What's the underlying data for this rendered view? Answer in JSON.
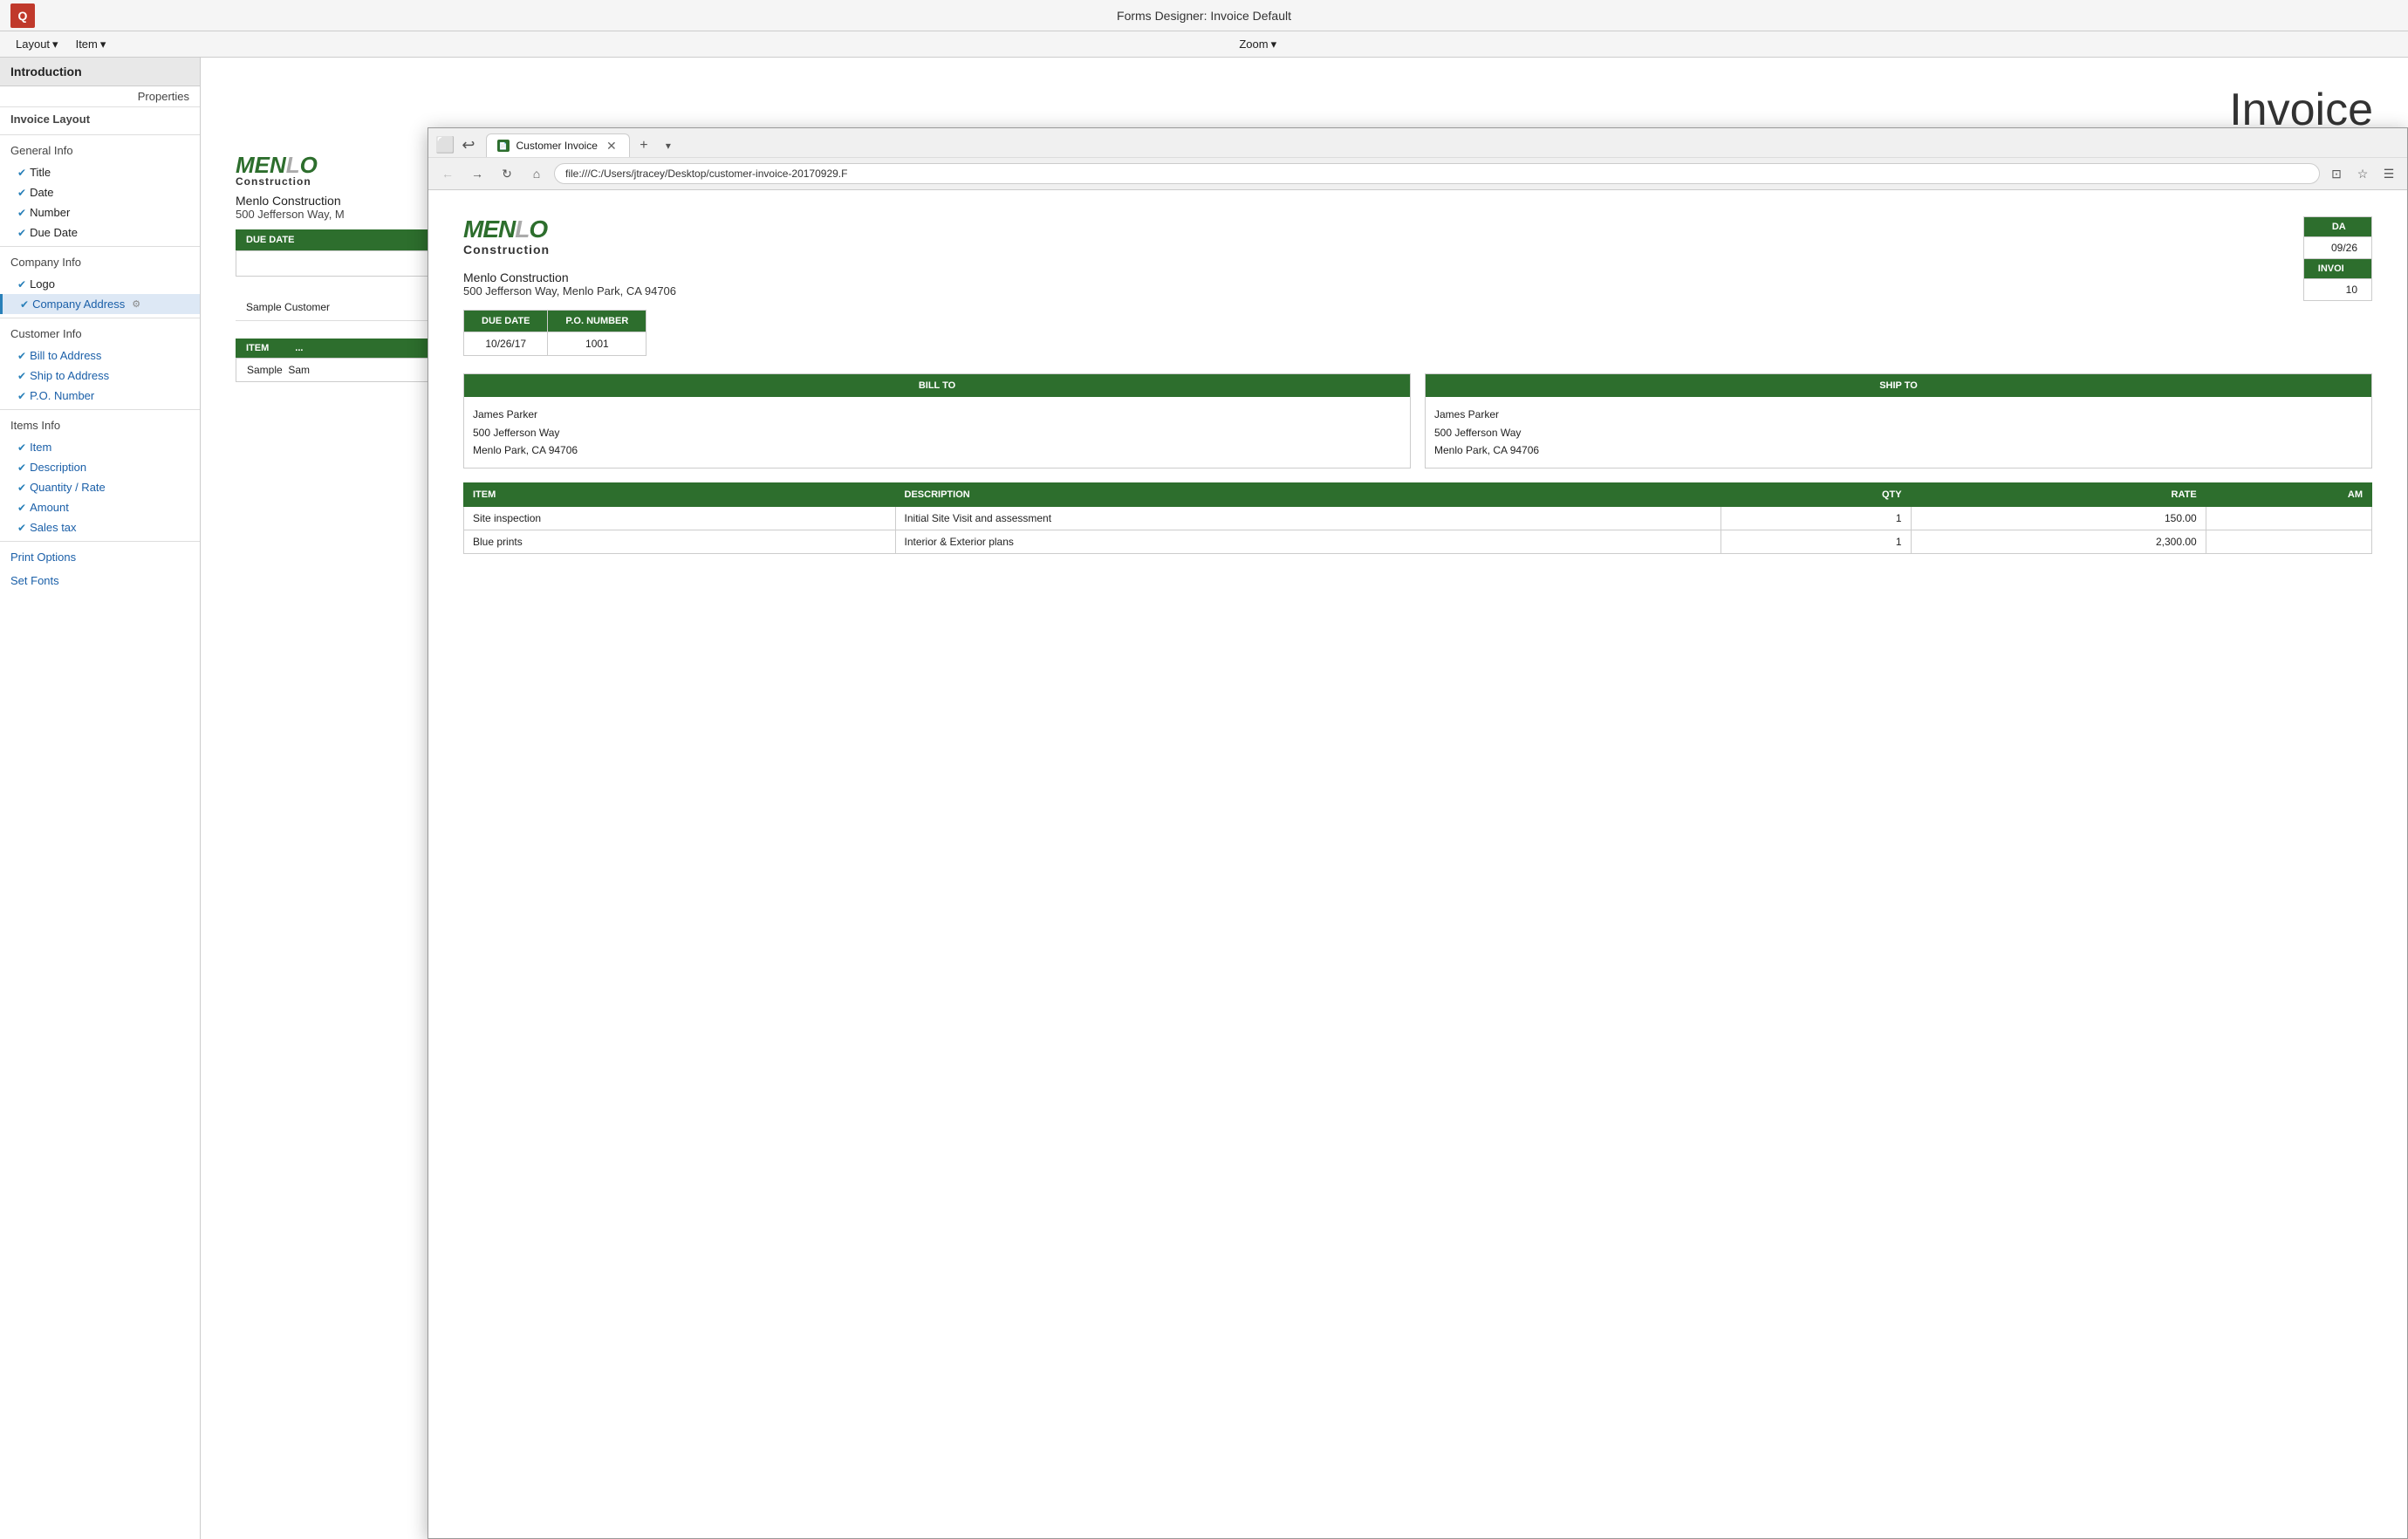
{
  "titleBar": {
    "logo": "Q",
    "title": "Forms Designer:  Invoice Default"
  },
  "menuBar": {
    "items": [
      {
        "label": "Layout",
        "hasArrow": true
      },
      {
        "label": "Item",
        "hasArrow": true
      },
      {
        "label": "Zoom",
        "hasArrow": true
      }
    ]
  },
  "leftPanel": {
    "header": "Introduction",
    "propertiesLabel": "Properties",
    "sections": [
      {
        "title": "Invoice Layout",
        "items": []
      },
      {
        "title": "General Info",
        "items": [
          {
            "label": "Title",
            "checked": true,
            "hasGear": false
          },
          {
            "label": "Date",
            "checked": true,
            "hasGear": false
          },
          {
            "label": "Number",
            "checked": true,
            "hasGear": false
          },
          {
            "label": "Due Date",
            "checked": true,
            "hasGear": false
          }
        ]
      },
      {
        "title": "Company Info",
        "items": [
          {
            "label": "Logo",
            "checked": true,
            "hasGear": false
          },
          {
            "label": "Company Address",
            "checked": true,
            "hasGear": true,
            "highlighted": true
          }
        ]
      },
      {
        "title": "Customer Info",
        "items": [
          {
            "label": "Bill to Address",
            "checked": true,
            "hasGear": false
          },
          {
            "label": "Ship to Address",
            "checked": true,
            "hasGear": false
          },
          {
            "label": "P.O. Number",
            "checked": true,
            "hasGear": false
          }
        ]
      },
      {
        "title": "Items Info",
        "items": [
          {
            "label": "Item",
            "checked": true,
            "hasGear": false
          },
          {
            "label": "Description",
            "checked": true,
            "hasGear": false
          },
          {
            "label": "Quantity / Rate",
            "checked": true,
            "hasGear": false
          },
          {
            "label": "Amount",
            "checked": true,
            "hasGear": false
          },
          {
            "label": "Sales tax",
            "checked": true,
            "hasGear": false
          }
        ]
      },
      {
        "title": "Print Options",
        "items": []
      },
      {
        "title": "Set Fonts",
        "items": []
      }
    ]
  },
  "invoicePreview": {
    "title": "Invoice",
    "logo": {
      "menlo": "MENLO",
      "construction": "Construction"
    },
    "company": {
      "name": "Menlo Construction",
      "address": "500 Jefferson Way, M"
    },
    "dueDate": {
      "header": "DUE DATE",
      "value": ""
    },
    "sampleCustomer": "Sample Customer",
    "itemBar": {
      "item": "ITEM",
      "sample": "Sam"
    }
  },
  "browser": {
    "tab": {
      "label": "Customer Invoice",
      "favicon": "📄"
    },
    "addressBar": "file:///C:/Users/jtracey/Desktop/customer-invoice-20170929.F",
    "invoice": {
      "logo": {
        "menlo": "MENLO",
        "construction": "Construction"
      },
      "company": {
        "name": "Menlo Construction",
        "address": "500 Jefferson Way, Menlo Park, CA 94706"
      },
      "dueDateTable": {
        "headers": [
          "DUE DATE",
          "P.O. NUMBER"
        ],
        "values": [
          "10/26/17",
          "1001"
        ]
      },
      "rightInfo": {
        "dateLabel": "DA",
        "dateValue": "09/26",
        "invoiceLabel": "INVOI",
        "invoiceValue": "10"
      },
      "billTo": {
        "header": "BILL TO",
        "name": "James Parker",
        "address1": "500 Jefferson Way",
        "address2": "Menlo Park, CA 94706"
      },
      "shipTo": {
        "header": "SHIP TO",
        "name": "James Parker",
        "address1": "500 Jefferson Way",
        "address2": "Menlo Park, CA 94706"
      },
      "itemsTable": {
        "headers": [
          "ITEM",
          "DESCRIPTION",
          "QTY",
          "RATE",
          "AM"
        ],
        "rows": [
          {
            "item": "Site inspection",
            "description": "Initial Site Visit and assessment",
            "qty": "1",
            "rate": "150.00"
          },
          {
            "item": "Blue prints",
            "description": "Interior & Exterior plans",
            "qty": "1",
            "rate": "2,300.00"
          }
        ]
      }
    }
  }
}
